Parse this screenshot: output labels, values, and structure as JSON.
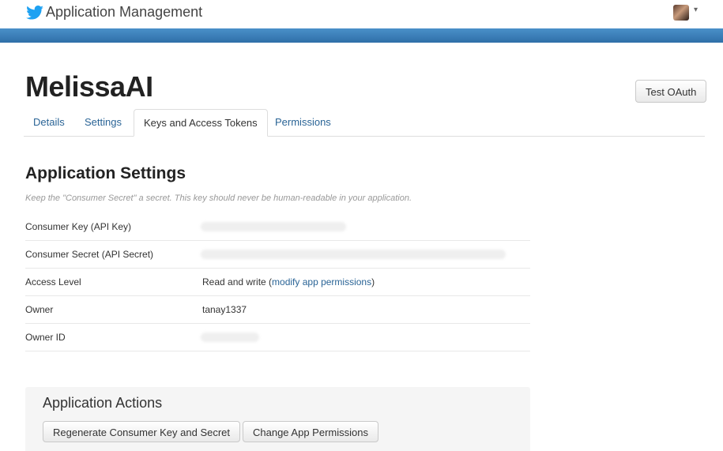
{
  "topbar": {
    "app_title": "Application Management",
    "logo_icon": "twitter-bird-icon",
    "brand_color": "#1da1f2",
    "bar_color": "#3b7fbf"
  },
  "app": {
    "name": "MelissaAI",
    "test_oauth_label": "Test OAuth"
  },
  "tabs": [
    {
      "label": "Details",
      "active": false
    },
    {
      "label": "Settings",
      "active": false
    },
    {
      "label": "Keys and Access Tokens",
      "active": true
    },
    {
      "label": "Permissions",
      "active": false
    }
  ],
  "settings": {
    "title": "Application Settings",
    "note": "Keep the \"Consumer Secret\" a secret. This key should never be human-readable in your application.",
    "rows": [
      {
        "label": "Consumer Key (API Key)",
        "value": ""
      },
      {
        "label": "Consumer Secret (API Secret)",
        "value": ""
      },
      {
        "label": "Access Level",
        "value": "Read and write (",
        "link": "modify app permissions",
        "suffix": ")"
      },
      {
        "label": "Owner",
        "value": "tanay1337"
      },
      {
        "label": "Owner ID",
        "value": ""
      }
    ]
  },
  "actions": {
    "title": "Application Actions",
    "regenerate_label": "Regenerate Consumer Key and Secret",
    "change_permissions_label": "Change App Permissions"
  }
}
